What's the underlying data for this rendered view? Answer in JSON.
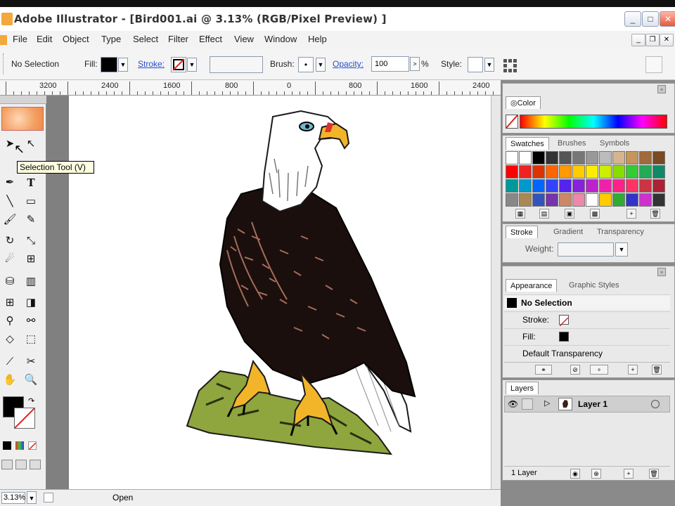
{
  "window": {
    "title": "Adobe Illustrator - [Bird001.ai @ 3.13% (RGB/Pixel Preview) ]",
    "controls": [
      "_",
      "□",
      "✕"
    ]
  },
  "menu": {
    "items": [
      "File",
      "Edit",
      "Object",
      "Type",
      "Select",
      "Filter",
      "Effect",
      "View",
      "Window",
      "Help"
    ]
  },
  "control_bar": {
    "selection_label": "No Selection",
    "fill_label": "Fill:",
    "stroke_label": "Stroke:",
    "brush_label": "Brush:",
    "brush_value": "•",
    "opacity_label": "Opacity:",
    "opacity_value": "100",
    "opacity_unit": "%",
    "style_label": "Style:"
  },
  "ruler": {
    "labels": [
      "3200",
      "2400",
      "1600",
      "800",
      "0",
      "800",
      "1600",
      "2400"
    ]
  },
  "tooltip": "Selection Tool (V)",
  "status_bar": {
    "zoom": "3.13%",
    "mode": "Open"
  },
  "color_panel": {
    "tab": "Color"
  },
  "swatches_panel": {
    "tabs": [
      "Swatches",
      "Brushes",
      "Symbols"
    ]
  },
  "stroke_panel": {
    "tabs": [
      "Stroke",
      "Gradient",
      "Transparency"
    ],
    "weight_label": "Weight:"
  },
  "appearance_panel": {
    "tabs": [
      "Appearance",
      "Graphic Styles"
    ],
    "header": "No Selection",
    "stroke_label": "Stroke:",
    "fill_label": "Fill:",
    "transparency_label": "Default Transparency"
  },
  "layers_panel": {
    "tab": "Layers",
    "layer_name": "Layer 1",
    "footer": "1 Layer"
  },
  "colors": {
    "accent_link": "#2a4ec8",
    "tooltip_bg": "#ffffe1",
    "eagle_body": "#1a0f0c",
    "eagle_feather": "#a66c5c",
    "beak": "#f2b52a",
    "rock": "#8fa53e"
  },
  "icons": [
    "app-icon",
    "selection-arrow-icon",
    "direct-selection-icon",
    "pen-icon",
    "type-icon",
    "line-icon",
    "rectangle-icon",
    "paintbrush-icon",
    "pencil-icon",
    "rotate-icon",
    "scale-icon",
    "warp-icon",
    "free-transform-icon",
    "symbol-sprayer-icon",
    "graph-icon",
    "mesh-icon",
    "gradient-icon",
    "eyedropper-icon",
    "blend-icon",
    "scissors-icon",
    "hand-icon",
    "zoom-icon",
    "fill-swatch-icon",
    "stroke-swatch-icon"
  ]
}
